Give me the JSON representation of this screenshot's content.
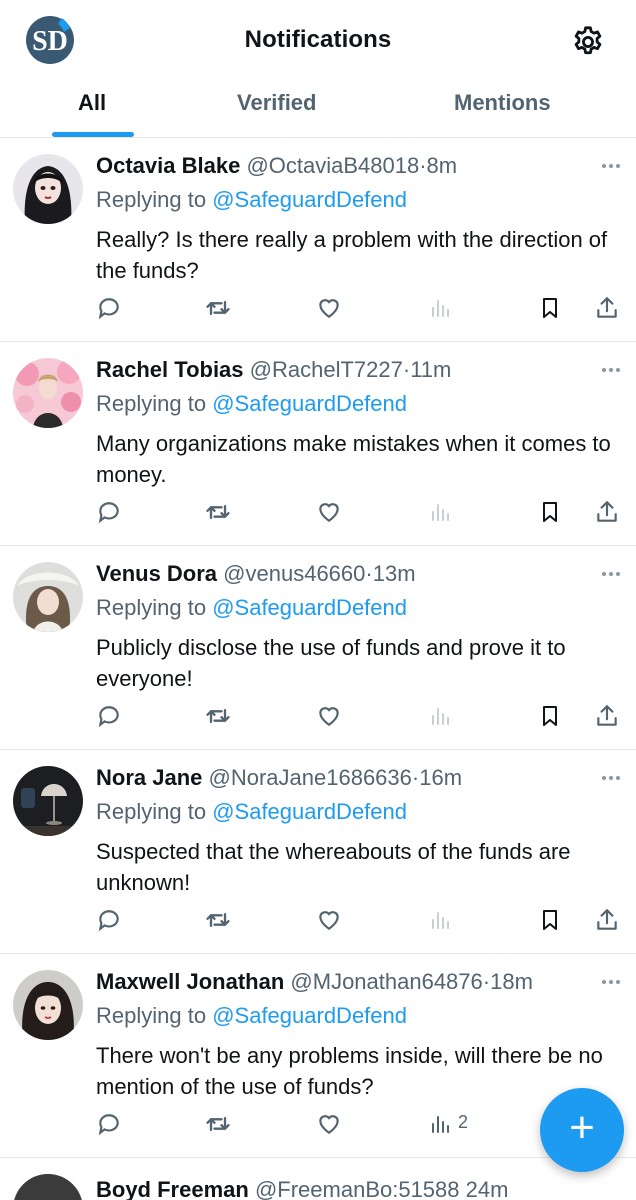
{
  "header": {
    "title": "Notifications",
    "logo_text": "SD",
    "settings_icon": "gear-icon"
  },
  "tabs": [
    {
      "label": "All",
      "active": true
    },
    {
      "label": "Verified",
      "active": false
    },
    {
      "label": "Mentions",
      "active": false
    }
  ],
  "tweets": [
    {
      "name": "Octavia Blake",
      "handle": "@OctaviaB48018",
      "dot": "·",
      "time": "8m",
      "replying_prefix": "Replying to",
      "replying_to": "@SafeguardDefend",
      "text": "Really? Is there really a problem with the direction of the funds?",
      "views": ""
    },
    {
      "name": "Rachel Tobias",
      "handle": "@RachelT7227",
      "dot": "·",
      "time": "11m",
      "replying_prefix": "Replying to",
      "replying_to": "@SafeguardDefend",
      "text": "Many organizations make mistakes when it comes to money.",
      "views": ""
    },
    {
      "name": "Venus Dora",
      "handle": "@venus46660",
      "dot": "·",
      "time": "13m",
      "replying_prefix": "Replying to",
      "replying_to": "@SafeguardDefend",
      "text": "Publicly disclose the use of funds and prove it to everyone!",
      "views": ""
    },
    {
      "name": "Nora Jane",
      "handle": "@NoraJane1686636",
      "dot": "·",
      "time": "16m",
      "replying_prefix": "Replying to",
      "replying_to": "@SafeguardDefend",
      "text": "Suspected that the whereabouts of the funds are unknown!",
      "views": ""
    },
    {
      "name": "Maxwell Jonathan",
      "handle": "@MJonathan64876",
      "dot": "·",
      "time": "18m",
      "replying_prefix": "Replying to",
      "replying_to": "@SafeguardDefend",
      "text": "There won't be any problems inside, will there be no mention of the use of funds?",
      "views": "2"
    }
  ],
  "partial_tweet": {
    "name": "Boyd Freeman",
    "handle": "@FreemanBo:51588",
    "time": "24m"
  },
  "fab": {
    "label": "+"
  },
  "colors": {
    "accent": "#1d9bf0",
    "text": "#0f1419",
    "muted": "#536471",
    "divider": "#e6e9ec"
  },
  "icons": [
    "reply-icon",
    "retweet-icon",
    "like-icon",
    "views-icon",
    "bookmark-icon",
    "share-icon",
    "more-icon"
  ]
}
